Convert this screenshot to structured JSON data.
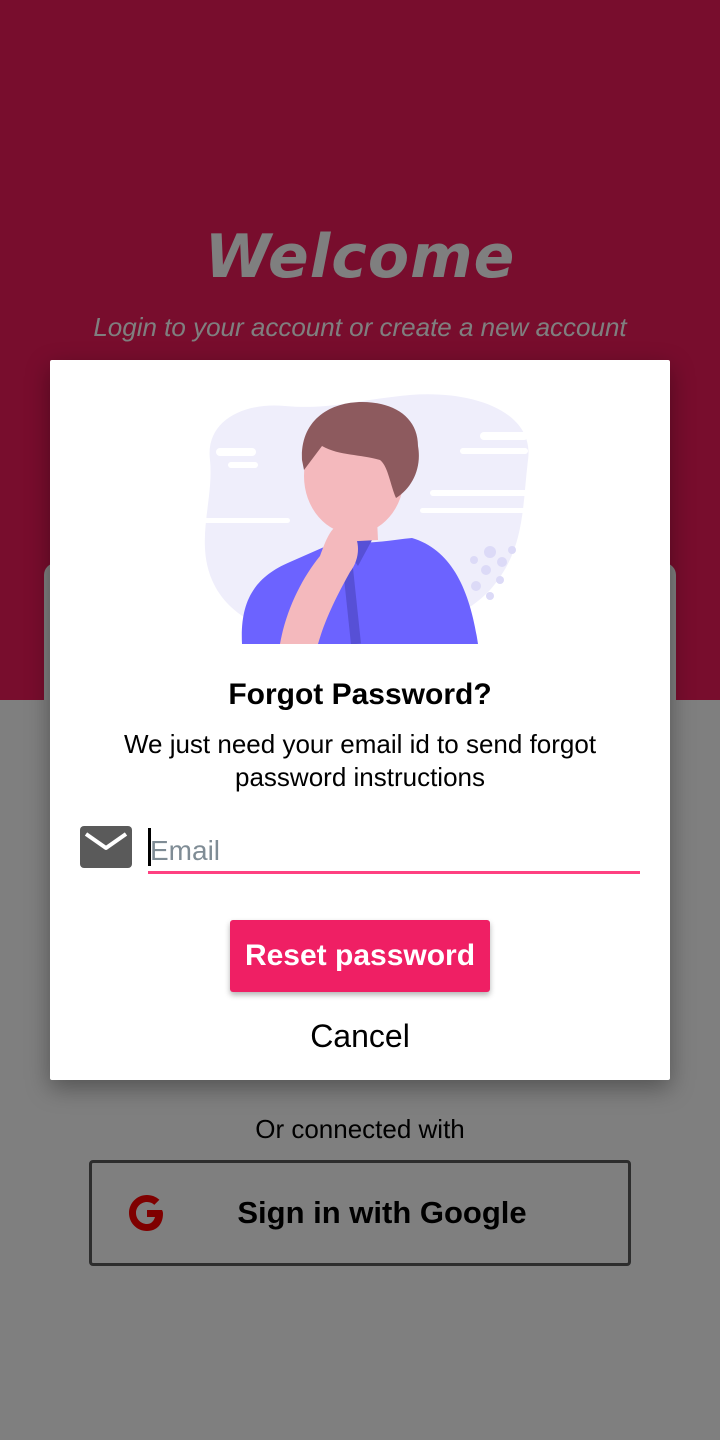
{
  "screen": {
    "welcome_title": "Welcome",
    "welcome_subtitle": "Login to your account or create a new account",
    "connected_text": "Or connected with",
    "google_button_label": "Sign in with Google",
    "hero_color": "#f01a5b"
  },
  "dialog": {
    "illustration": "thinking-person-illustration",
    "title": "Forgot Password?",
    "message": "We just need your email id to send forgot password instructions",
    "email_icon": "mail-icon",
    "email_placeholder": "Email",
    "email_value": "",
    "reset_label": "Reset password",
    "cancel_label": "Cancel",
    "accent_color": "#ef1f64"
  }
}
